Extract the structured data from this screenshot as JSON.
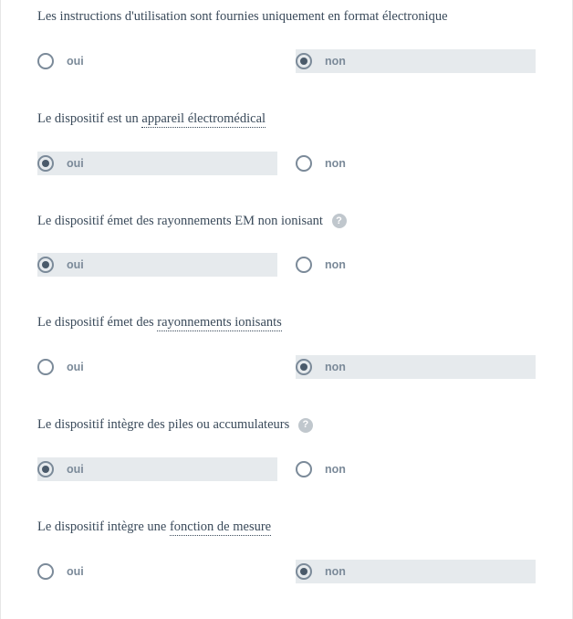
{
  "labels": {
    "yes": "oui",
    "no": "non",
    "help": "?"
  },
  "questions": [
    {
      "id": "q1",
      "text_plain": "Les instructions d'utilisation sont fournies uniquement en format électronique",
      "has_help": false,
      "selected": "no"
    },
    {
      "id": "q2",
      "text_before": "Le dispositif est un ",
      "text_underlined": "appareil électromédical",
      "has_help": false,
      "selected": "yes"
    },
    {
      "id": "q3",
      "text_plain": "Le dispositif émet des rayonnements EM non ionisant",
      "has_help": true,
      "selected": "yes"
    },
    {
      "id": "q4",
      "text_before": "Le dispositif émet des ",
      "text_underlined": "rayonnements ionisants",
      "has_help": false,
      "selected": "no"
    },
    {
      "id": "q5",
      "text_plain": "Le dispositif intègre des piles ou accumulateurs",
      "has_help": true,
      "selected": "yes"
    },
    {
      "id": "q6",
      "text_before": "Le dispositif intègre une ",
      "text_underlined": "fonction de mesure",
      "has_help": false,
      "selected": "no"
    }
  ]
}
